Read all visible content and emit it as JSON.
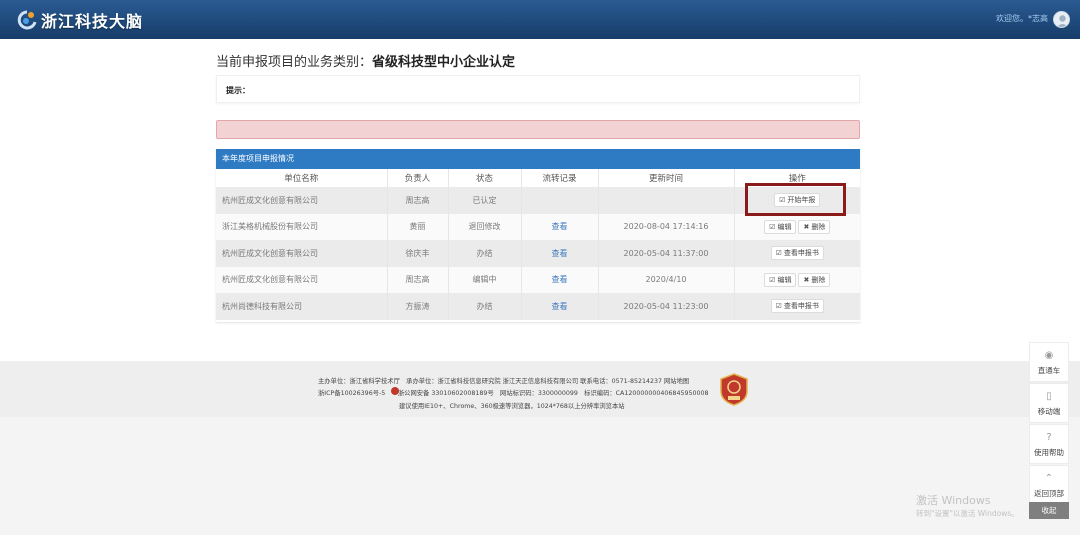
{
  "header": {
    "logo_text": "浙江科技大脑",
    "welcome": "欢迎您。*志高"
  },
  "page": {
    "category_prefix": "当前申报项目的业务类别：",
    "category_value": "省级科技型中小企业认定",
    "hint_label": "提示："
  },
  "panel": {
    "title": "本年度项目申报情况",
    "columns": [
      "单位名称",
      "负责人",
      "状态",
      "流转记录",
      "更新时间",
      "操作"
    ],
    "rows": [
      {
        "unit": "杭州匠成文化创意有限公司",
        "person": "周志高",
        "status": "已认定",
        "flow": "",
        "time": "",
        "ops": [
          "开始年报"
        ]
      },
      {
        "unit": "浙江美格机械股份有限公司",
        "person": "黄丽",
        "status": "退回修改",
        "flow": "查看",
        "time": "2020-08-04 17:14:16",
        "ops": [
          "编辑",
          "删除"
        ]
      },
      {
        "unit": "杭州匠成文化创意有限公司",
        "person": "徐庆丰",
        "status": "办结",
        "flow": "查看",
        "time": "2020-05-04 11:37:00",
        "ops": [
          "查看申报书"
        ]
      },
      {
        "unit": "杭州匠成文化创意有限公司",
        "person": "周志高",
        "status": "编辑中",
        "flow": "查看",
        "time": "2020/4/10",
        "ops": [
          "编辑",
          "删除"
        ]
      },
      {
        "unit": "杭州尚德科技有限公司",
        "person": "方振涛",
        "status": "办结",
        "flow": "查看",
        "time": "2020-05-04 11:23:00",
        "ops": [
          "查看申报书"
        ]
      }
    ]
  },
  "footer": {
    "line1": "主办单位：浙江省科学技术厅　承办单位：浙江省科技信息研究院 浙江天正信息科技有限公司 联系电话：0571-85214237 网站地图",
    "line2": "浙ICP备10026396号-5　　浙公网安备 33010602008189号　网站标识码：3300000099　标识编码：CA120000000406845950008",
    "line3": "建议使用IE10+、Chrome、360极速等浏览器，1024*768以上分辨率浏览本站"
  },
  "side_tools": [
    {
      "label": "直通车",
      "icon": "car-icon"
    },
    {
      "label": "移动端",
      "icon": "mobile-icon"
    },
    {
      "label": "使用帮助",
      "icon": "help-icon"
    },
    {
      "label": "返回顶部",
      "icon": "arrow-up-icon"
    }
  ],
  "collapse_label": "收起",
  "watermark": {
    "line1": "激活 Windows",
    "line2": "转到\"设置\"以激活 Windows。"
  },
  "colors": {
    "topbar": "#1f4a7c",
    "panel_head": "#2e7bc4",
    "alert": "#f3d2d3",
    "highlight": "#8b1a1a",
    "link": "#3b78c0"
  }
}
